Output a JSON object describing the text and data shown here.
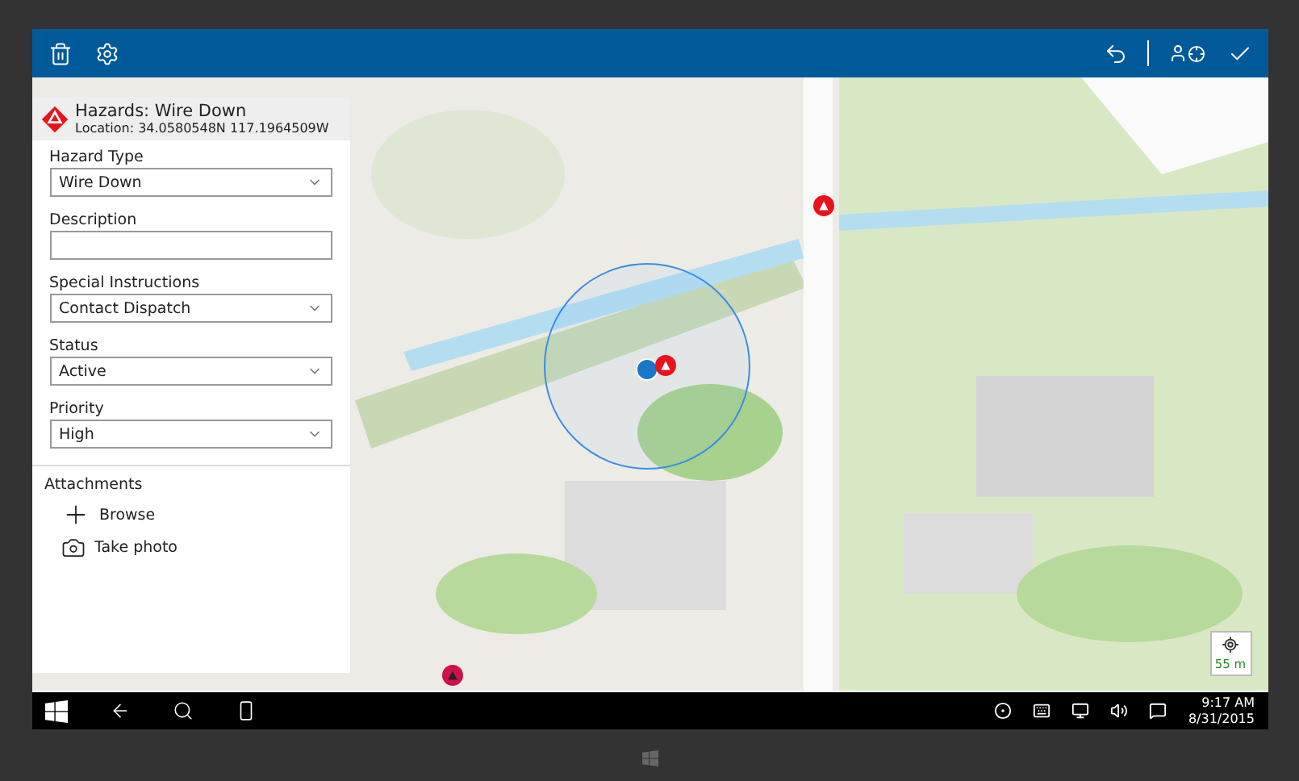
{
  "app_bar": {
    "left_buttons": [
      {
        "kind": "delete"
      },
      {
        "kind": "settings"
      }
    ],
    "right_buttons": [
      {
        "kind": "undo"
      },
      {
        "kind": "locate-user"
      },
      {
        "kind": "confirm"
      }
    ]
  },
  "form": {
    "title": "Hazards: Wire Down",
    "location": "Location: 34.0580548N 117.1964509W",
    "fields": [
      {
        "kind": "dropdown",
        "label": "Hazard Type",
        "value": "Wire Down"
      },
      {
        "kind": "text",
        "label": "Description"
      },
      {
        "kind": "dropdown",
        "label": "Special Instructions",
        "value": "Contact Dispatch"
      },
      {
        "kind": "dropdown",
        "label": "Status",
        "value": "Active"
      },
      {
        "kind": "dropdown",
        "label": "Priority",
        "value": "High"
      }
    ],
    "attachments": {
      "label": "Attachments",
      "actions": [
        {
          "kind": "browse",
          "label": "Browse"
        },
        {
          "label": "Take photo"
        }
      ]
    }
  },
  "map": {
    "kind": "picture",
    "scale": "55 m"
  },
  "taskbar": {
    "left": [
      {
        "kind": "start"
      },
      {
        "kind": "back"
      },
      {
        "kind": "search"
      },
      {
        "kind": "task-view"
      }
    ],
    "tray": [
      {
        "kind": "record"
      },
      {
        "kind": "keyboard"
      },
      {
        "kind": "network"
      },
      {
        "kind": "volume"
      },
      {
        "kind": "notifications"
      }
    ],
    "time": "9:17 AM",
    "date": "8/31/2015"
  }
}
